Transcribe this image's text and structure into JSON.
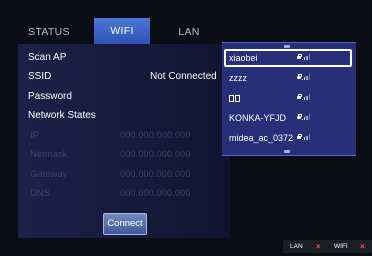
{
  "tabs": [
    {
      "label": "STATUS",
      "selected": false
    },
    {
      "label": "WIFI",
      "selected": true
    },
    {
      "label": "LAN",
      "selected": false
    }
  ],
  "form": {
    "scan_ap": "Scan AP",
    "ssid_label": "SSID",
    "ssid_value": "Not Connected",
    "password_label": "Password",
    "network_states_label": "Network States"
  },
  "network_fields": [
    {
      "label": "IP",
      "value": "000.000.000.000"
    },
    {
      "label": "Netmask",
      "value": "000.000.000.000"
    },
    {
      "label": "Gateway",
      "value": "000.000.000.000"
    },
    {
      "label": "DNS",
      "value": "000.000.000.000"
    }
  ],
  "connect_label": "Connect",
  "ap_list": [
    {
      "name": "xiaobei",
      "selected": true,
      "locked": true
    },
    {
      "name": "zzzz",
      "selected": false,
      "locked": true
    },
    {
      "name": "",
      "unrenderable_chars": 2,
      "selected": false,
      "locked": true
    },
    {
      "name": "KONKA-YFJD",
      "selected": false,
      "locked": true
    },
    {
      "name": "midea_ac_0372",
      "selected": false,
      "locked": true
    }
  ],
  "status_bar": {
    "lan_label": "LAN",
    "lan_state": "×",
    "wifi_label": "WIFI",
    "wifi_state": "×"
  },
  "colors": {
    "tab_active": "#3a63c9",
    "panel_bg": "#181d42",
    "ap_list_bg": "#272f78",
    "disconnected_mark": "#ff4a4a"
  }
}
